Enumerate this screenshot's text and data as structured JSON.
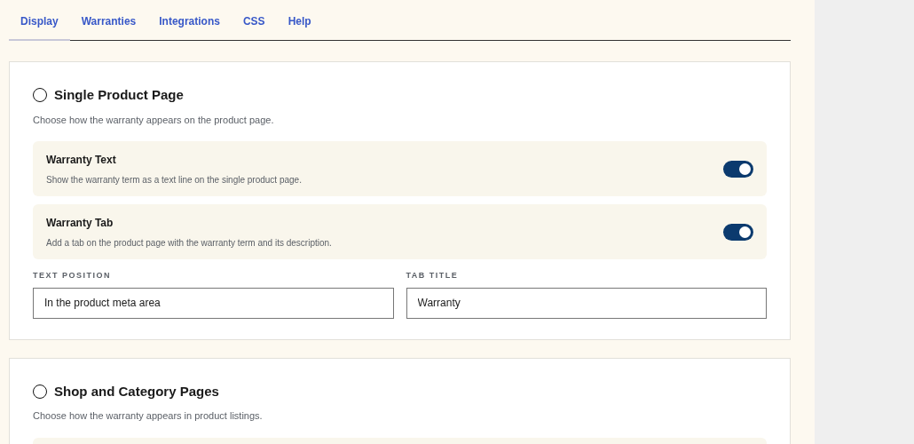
{
  "tabs": [
    {
      "label": "Display",
      "selected": true
    },
    {
      "label": "Warranties",
      "selected": false
    },
    {
      "label": "Integrations",
      "selected": false
    },
    {
      "label": "CSS",
      "selected": false
    },
    {
      "label": "Help",
      "selected": false
    }
  ],
  "sections": [
    {
      "title": "Single Product Page",
      "description": "Choose how the warranty appears on the product page.",
      "checked": false,
      "toggles": [
        {
          "title": "Warranty Text",
          "description": "Show the warranty term as a text line on the single product page.",
          "on": true
        },
        {
          "title": "Warranty Tab",
          "description": "Add a tab on the product page with the warranty term and its description.",
          "on": true
        }
      ],
      "fields": [
        {
          "label": "TEXT POSITION",
          "value": "In the product meta area"
        },
        {
          "label": "TAB TITLE",
          "value": "Warranty"
        }
      ]
    },
    {
      "title": "Shop and Category Pages",
      "description": "Choose how the warranty appears in product listings.",
      "checked": false,
      "more_below": true
    }
  ]
}
